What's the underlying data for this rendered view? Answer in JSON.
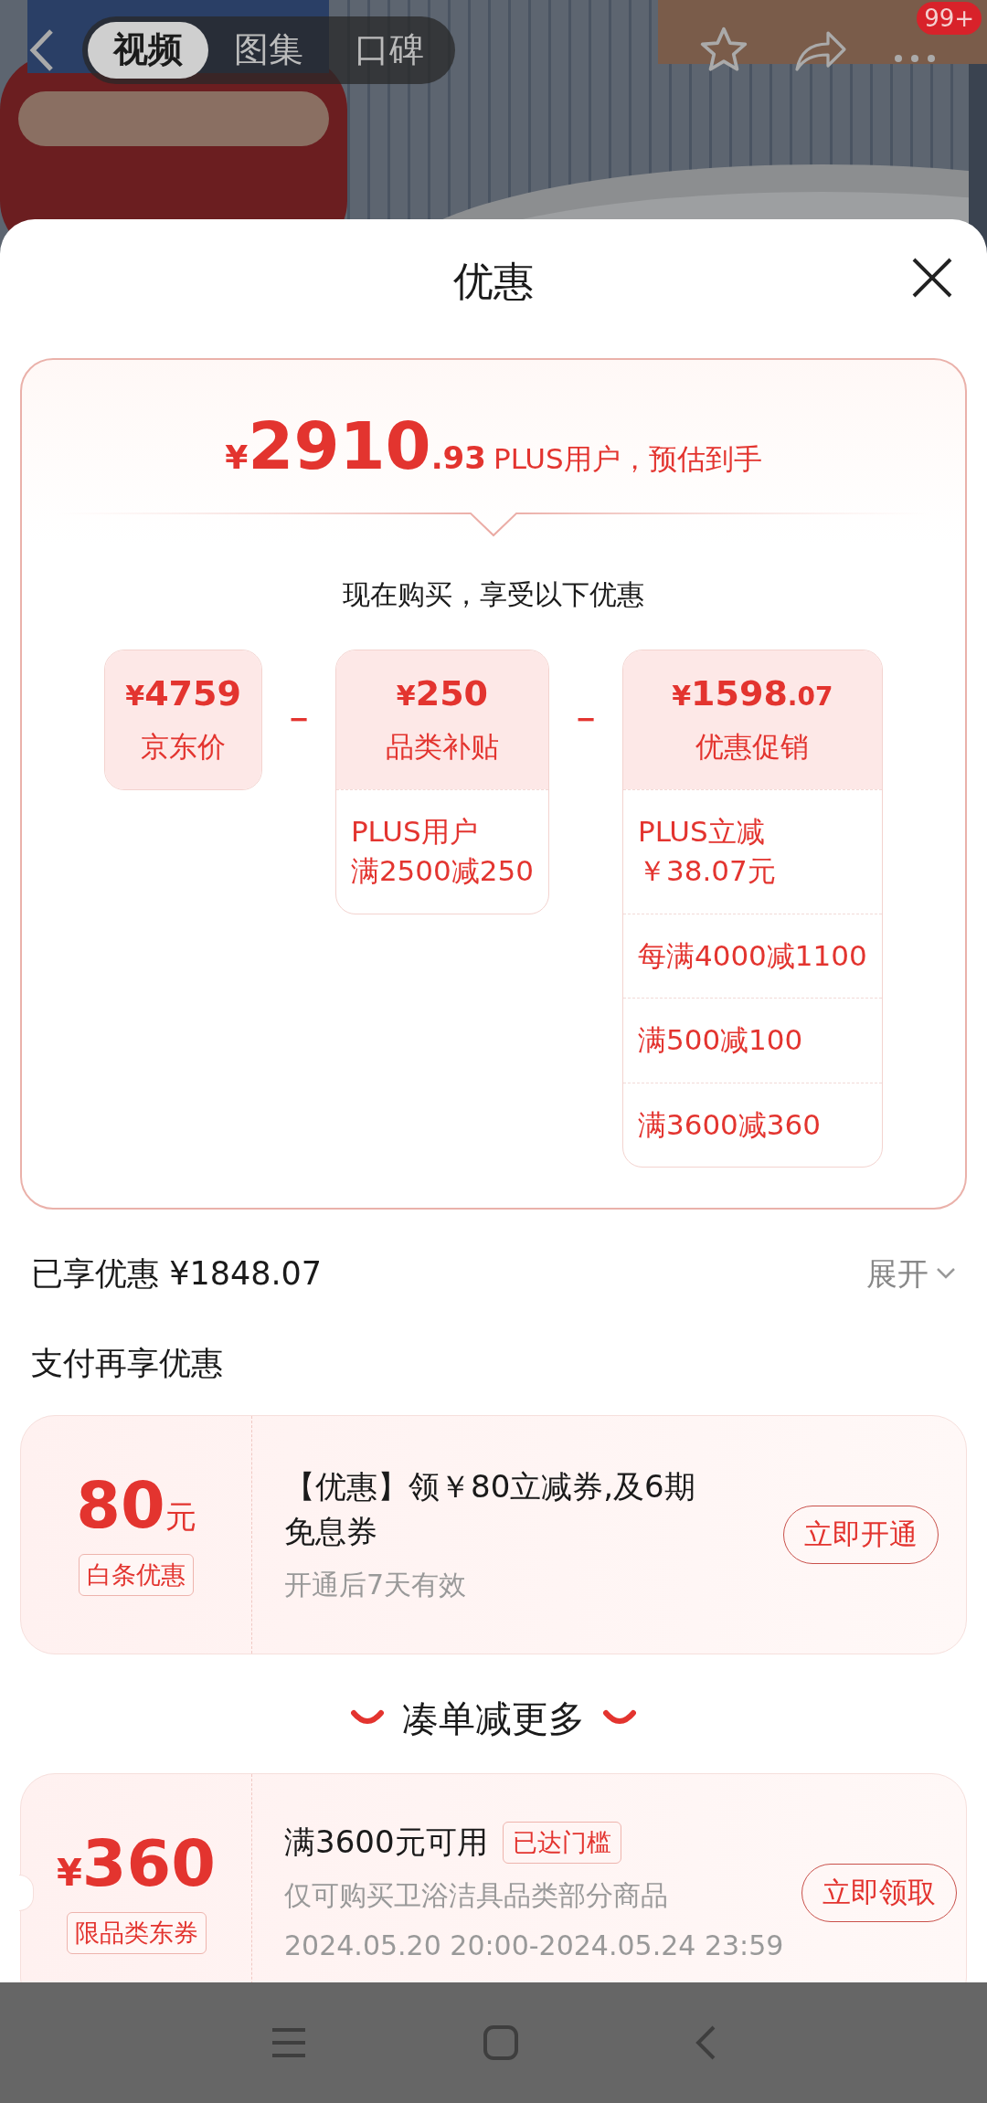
{
  "header": {
    "tabs": [
      {
        "label": "视频",
        "selected": true
      },
      {
        "label": "图集",
        "selected": false
      },
      {
        "label": "口碑",
        "selected": false
      }
    ],
    "more_badge": "99+"
  },
  "sheet": {
    "title": "优惠"
  },
  "estimate": {
    "currency": "¥",
    "integer": "2910",
    "decimal": ".93",
    "note": "PLUS用户，预估到手"
  },
  "subtitle": "现在购买，享受以下优惠",
  "breakdown": [
    {
      "currency": "¥",
      "integer": "4759",
      "label": "京东价"
    },
    {
      "operator": "－",
      "currency": "¥",
      "integer": "250",
      "label": "品类补贴",
      "details": [
        [
          "PLUS用户",
          "满2500减250"
        ]
      ]
    },
    {
      "operator": "－",
      "currency": "¥",
      "integer": "1598",
      "decimal": ".07",
      "label": "优惠促销",
      "details": [
        [
          "PLUS立减",
          "￥38.07元"
        ],
        [
          "每满4000减1100"
        ],
        [
          "满500减100"
        ],
        [
          "满3600减360"
        ]
      ]
    }
  ],
  "saved": {
    "label": "已享优惠 ¥1848.07",
    "toggle": "展开"
  },
  "pay_section": {
    "title": "支付再享优惠",
    "coupons": [
      {
        "amount": "80",
        "unit": "元",
        "tag": "白条优惠",
        "title": "【优惠】领￥80立减券,及6期免息券",
        "lines": [
          "开通后7天有效"
        ],
        "button": "立即开通"
      }
    ]
  },
  "more_section": {
    "title": "凑单减更多",
    "coupons": [
      {
        "currency": "¥",
        "amount": "360",
        "tag": "限品类东券",
        "title": "满3600元可用",
        "badge": "已达门槛",
        "lines": [
          "仅可购买卫浴洁具品类部分商品",
          "2024.05.20 20:00-2024.05.24 23:59"
        ],
        "button": "立即领取"
      }
    ]
  }
}
